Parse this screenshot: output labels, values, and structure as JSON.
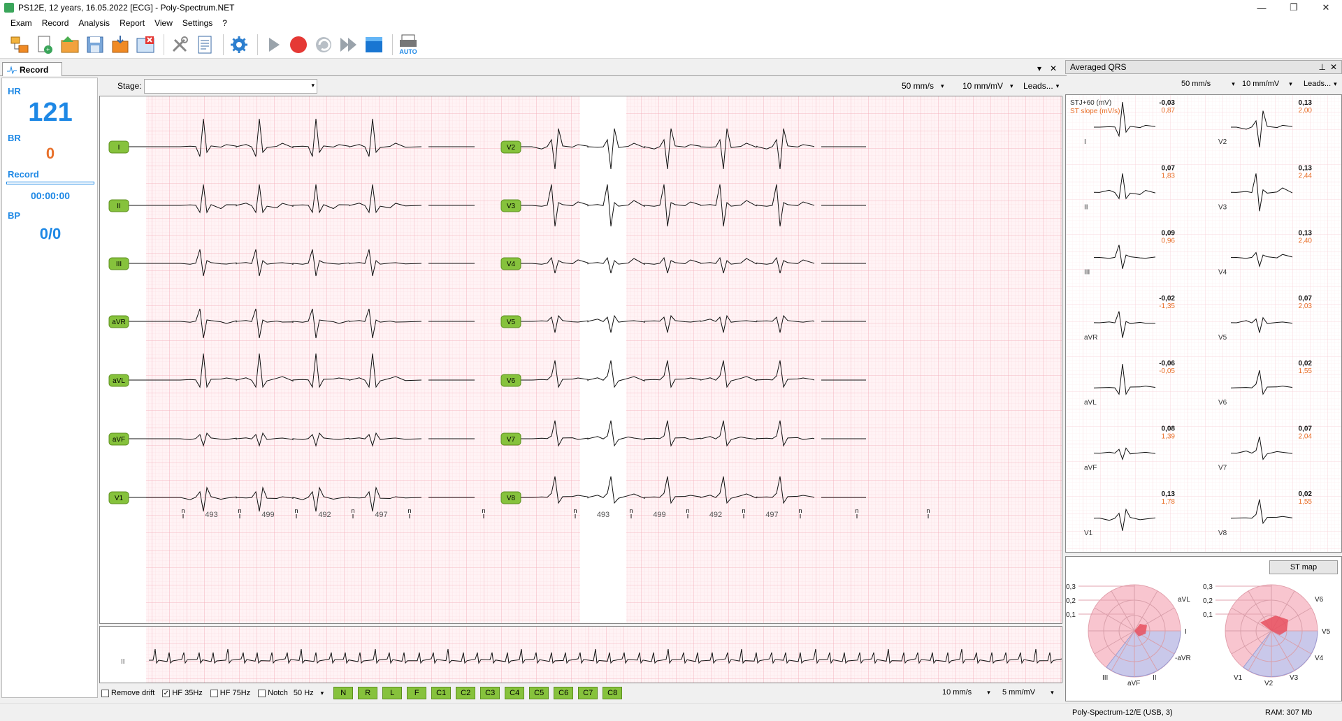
{
  "window": {
    "title": "PS12E, 12 years, 16.05.2022 [ECG] - Poly-Spectrum.NET",
    "min": "—",
    "max": "❐",
    "close": "✕"
  },
  "menu": [
    "Exam",
    "Record",
    "Analysis",
    "Report",
    "View",
    "Settings",
    "?"
  ],
  "toolbar": {
    "auto_label": "AUTO"
  },
  "record_tab": {
    "label": "Record"
  },
  "vitals": {
    "hr_label": "HR",
    "hr_value": "121",
    "br_label": "BR",
    "br_value": "0",
    "record_label": "Record",
    "record_time": "00:00:00",
    "bp_label": "BP",
    "bp_value": "0/0"
  },
  "stage": {
    "label": "Stage:",
    "value": ""
  },
  "main_controls": {
    "speed": "50 mm/s",
    "gain": "10 mm/mV",
    "leads": "Leads..."
  },
  "leads_left": [
    "I",
    "II",
    "III",
    "aVR",
    "aVL",
    "aVF",
    "V1"
  ],
  "leads_right": [
    "V2",
    "V3",
    "V4",
    "V5",
    "V6",
    "V7",
    "V8"
  ],
  "beat_marker": "n",
  "rr_intervals": [
    "493",
    "499",
    "492",
    "497"
  ],
  "rhythm_lead": "II",
  "filters": {
    "remove_drift": {
      "label": "Remove drift",
      "checked": false
    },
    "hf35": {
      "label": "HF 35Hz",
      "checked": true
    },
    "hf75": {
      "label": "HF 75Hz",
      "checked": false
    },
    "notch": {
      "label": "Notch",
      "checked": false
    },
    "notch_freq": "50 Hz"
  },
  "electrode_buttons": [
    "N",
    "R",
    "L",
    "F",
    "C1",
    "C2",
    "C3",
    "C4",
    "C5",
    "C6",
    "C7",
    "C8"
  ],
  "rhythm_controls": {
    "speed": "10 mm/s",
    "gain": "5 mm/mV"
  },
  "averaged_qrs": {
    "title": "Averaged QRS",
    "speed": "50 mm/s",
    "gain": "10 mm/mV",
    "leads": "Leads...",
    "stj_label": "STJ+60 (mV)",
    "slope_label": "ST slope (mV/s)",
    "left": [
      {
        "lead": "I",
        "stj": "-0,03",
        "slope": "0,87"
      },
      {
        "lead": "II",
        "stj": "0,07",
        "slope": "1,83"
      },
      {
        "lead": "III",
        "stj": "0,09",
        "slope": "0,96"
      },
      {
        "lead": "aVR",
        "stj": "-0,02",
        "slope": "-1,35"
      },
      {
        "lead": "aVL",
        "stj": "-0,06",
        "slope": "-0,05"
      },
      {
        "lead": "aVF",
        "stj": "0,08",
        "slope": "1,39"
      },
      {
        "lead": "V1",
        "stj": "0,13",
        "slope": "1,78"
      }
    ],
    "right": [
      {
        "lead": "V2",
        "stj": "0,13",
        "slope": "2,00"
      },
      {
        "lead": "V3",
        "stj": "0,13",
        "slope": "2,44"
      },
      {
        "lead": "V4",
        "stj": "0,13",
        "slope": "2,40"
      },
      {
        "lead": "V5",
        "stj": "0,07",
        "slope": "2,03"
      },
      {
        "lead": "V6",
        "stj": "0,02",
        "slope": "1,55"
      },
      {
        "lead": "V7",
        "stj": "0,07",
        "slope": "2,04"
      },
      {
        "lead": "V8",
        "stj": "0,02",
        "slope": "1,55"
      }
    ]
  },
  "st_map": {
    "button": "ST map",
    "scale": [
      "0,3",
      "0,2",
      "0,1"
    ],
    "frontal_labels": [
      "aVL",
      "I",
      "-aVR",
      "II",
      "aVF",
      "III"
    ],
    "horizontal_labels": [
      "V6",
      "V5",
      "V4",
      "V3",
      "V2",
      "V1"
    ]
  },
  "status": {
    "device": "Poly-Spectrum-12/E (USB, 3)",
    "ram": "RAM: 307 Mb"
  },
  "colors": {
    "accent": "#1e88e5",
    "grid_minor": "#f7c7cf",
    "grid_major": "#f29aa8",
    "lead_badge": "#86c23c",
    "slope": "#e8702a",
    "alert": "#e53935"
  }
}
